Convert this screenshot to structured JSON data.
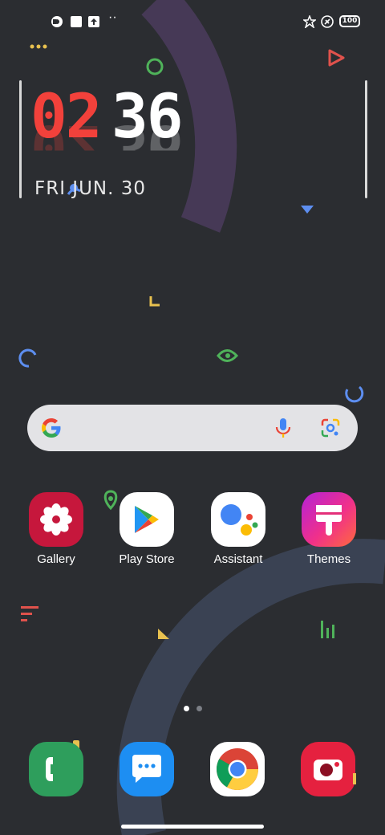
{
  "status_bar": {
    "battery": "100",
    "more": "··"
  },
  "clock": {
    "hour": "02",
    "minute": "36",
    "date": "FRI JUN. 30"
  },
  "apps": [
    {
      "name": "gallery",
      "label": "Gallery"
    },
    {
      "name": "play-store",
      "label": "Play Store"
    },
    {
      "name": "assistant",
      "label": "Assistant"
    },
    {
      "name": "themes",
      "label": "Themes"
    }
  ],
  "dock": [
    "phone",
    "messages",
    "chrome",
    "camera"
  ],
  "page_indicator": {
    "pages": 2,
    "current": 1
  },
  "colors": {
    "background": "#2b2d31",
    "clock_hour": "#f2413b",
    "gallery": "#c6173c",
    "phone": "#2e9e5c",
    "messages": "#1d8ef2",
    "camera": "#e5213f"
  }
}
